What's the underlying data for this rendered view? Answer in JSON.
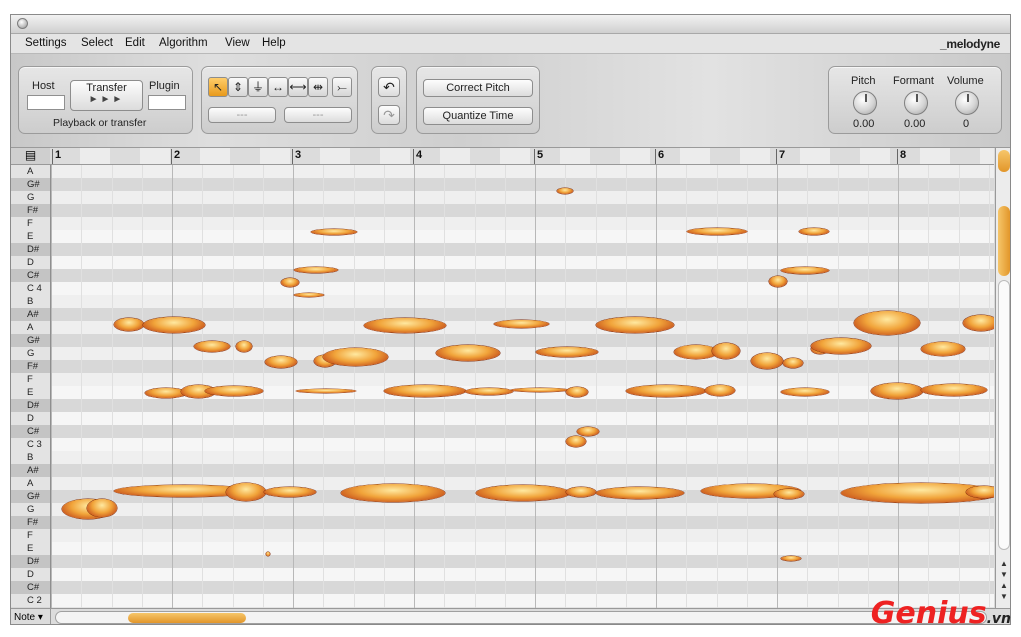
{
  "menu": [
    "Settings",
    "Select",
    "Edit",
    "Algorithm",
    "View",
    "Help"
  ],
  "logo": "_melodyne",
  "transfer": {
    "host_label": "Host",
    "transfer_label": "Transfer",
    "plugin_label": "Plugin",
    "play_glyph": "►►►",
    "caption": "Playback or transfer"
  },
  "tools": {
    "icons": [
      "pointer-icon",
      "pitch-tool-icon",
      "formant-tool-icon",
      "amplitude-tool-icon",
      "time-tool-icon",
      "stretch-tool-icon",
      "separation-tool-icon"
    ],
    "glyphs": [
      "↖",
      "⇕",
      "⏚",
      "↔",
      "⟷",
      "⇹",
      "⤚"
    ],
    "field1": "---",
    "field2": "---"
  },
  "actions": {
    "correct_pitch": "Correct Pitch",
    "quantize_time": "Quantize Time"
  },
  "undo_glyph": "↶",
  "redo_glyph": "↷",
  "knobs": [
    {
      "label": "Pitch",
      "value": "0.00"
    },
    {
      "label": "Formant",
      "value": "0.00"
    },
    {
      "label": "Volume",
      "value": "0"
    }
  ],
  "ruler_bars": [
    "1",
    "2",
    "3",
    "4",
    "5",
    "6",
    "7",
    "8"
  ],
  "keys": [
    "A",
    "G#",
    "G",
    "F#",
    "F",
    "E",
    "D#",
    "D",
    "C#",
    "C 4",
    "B",
    "A#",
    "A",
    "G#",
    "G",
    "F#",
    "F",
    "E",
    "D#",
    "D",
    "C#",
    "C 3",
    "B",
    "A#",
    "A",
    "G#",
    "G",
    "F#",
    "F",
    "E",
    "D#",
    "D",
    "C#",
    "C 2"
  ],
  "note_selector": "Note",
  "watermark": "Genius",
  "watermark_suffix": ".vn",
  "colors": {
    "blob": "#e8952f",
    "accent": "#f2a53a"
  }
}
